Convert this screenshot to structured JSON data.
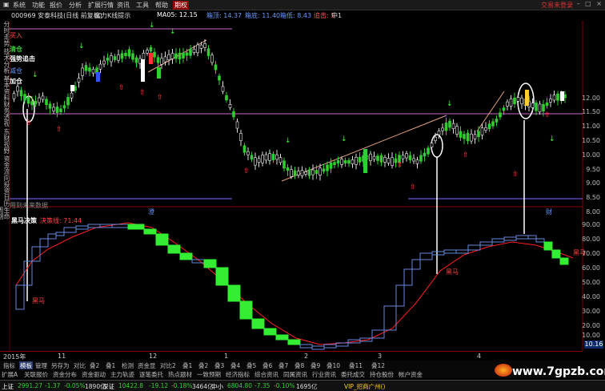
{
  "menu": {
    "items": [
      "系统",
      "功能",
      "报价",
      "分析",
      "扩展行情",
      "资讯",
      "工具",
      "帮助"
    ],
    "highlight": "期权",
    "right_label": "交易未登录"
  },
  "info": {
    "code_name": "000969 安泰科技(日线 前复权)",
    "indicator": "富力K线提示",
    "ma_label": "MA05: 12.15",
    "ma1": "箱顶: 14.37",
    "ma2": "箱底: 11.40",
    "ma3": "箱低: 8.43",
    "ma4": "追击: 1",
    "ma5": "中1"
  },
  "left_tools": [
    "分时走势",
    "技术分析",
    "基本资料",
    "财务透视",
    "东财视野",
    "资金流向",
    "投资日历",
    "生命周期"
  ],
  "signals": {
    "buy_in": "买入",
    "clear": "清仓",
    "strong_attack": "强势追击",
    "reduce": "减仓",
    "add": "加仓"
  },
  "price_axis": [
    "12.00",
    "11.50",
    "11.00",
    "10.50",
    "10.00",
    "9.50",
    "9.00",
    "8.50",
    "8.00"
  ],
  "lower_axis": [
    "90.00",
    "80.00",
    "70.00",
    "60.00",
    "50.00",
    "40.00",
    "30.00",
    "20.00",
    "10.00"
  ],
  "current_value": "10.16",
  "mid_labels": {
    "future_data": "用到未来数据",
    "mark_a": "澄",
    "mark_b": "财"
  },
  "lower_panel": {
    "title": "黑马决策",
    "param_label": "决策线: 71.44",
    "hm1": "黑马",
    "hm2": "黑马",
    "hm3": "黑马"
  },
  "dates": [
    "2015年",
    "11",
    "12",
    "1",
    "2",
    "3",
    "4"
  ],
  "tabs_row1": [
    "指标",
    "模板",
    "管理",
    "另存为",
    "对比",
    "叠2",
    "叠1",
    "检测",
    "资金显",
    "对比2",
    "叠1",
    "叠2",
    "叠3",
    "叠4",
    "叠5",
    "叠6",
    "叠7",
    "叠8",
    "叠9",
    "叠10",
    "叠11",
    "叠12"
  ],
  "tabs_row2": [
    "扩展A",
    "关联报价",
    "资金分布",
    "资金驱动",
    "主力轨迹",
    "逐笔委托",
    "热点题材",
    "一致预期",
    "经济指标",
    "综合资讯",
    "同属资讯",
    "行业资讯",
    "委托成交",
    "持仓股份",
    "帐户资金"
  ],
  "status": {
    "sh_label": "上证",
    "sh_value": "2991.27",
    "sh_change": "-1.37",
    "sh_pct": "-0.05%",
    "sh_amt": "1890亿",
    "sz_label": "深证",
    "sz_value": "10422.8",
    "sz_change": "-19.12",
    "sz_pct": "-0.18%",
    "sz_amt": "3464亿",
    "zx_label": "中小",
    "zx_value": "6804.80",
    "zx_change": "-7.35",
    "zx_pct": "-0.10%",
    "zx_amt": "1695亿",
    "vip": "VIP_招商广州()"
  },
  "watermark": "www.7gpzb.com",
  "colors": {
    "up": "#ffffff",
    "down": "#33cc33",
    "ma": "#cc66cc",
    "red_curve": "#ff2020",
    "blue_steps": "#6688dd",
    "green_steps": "#33ee33"
  }
}
